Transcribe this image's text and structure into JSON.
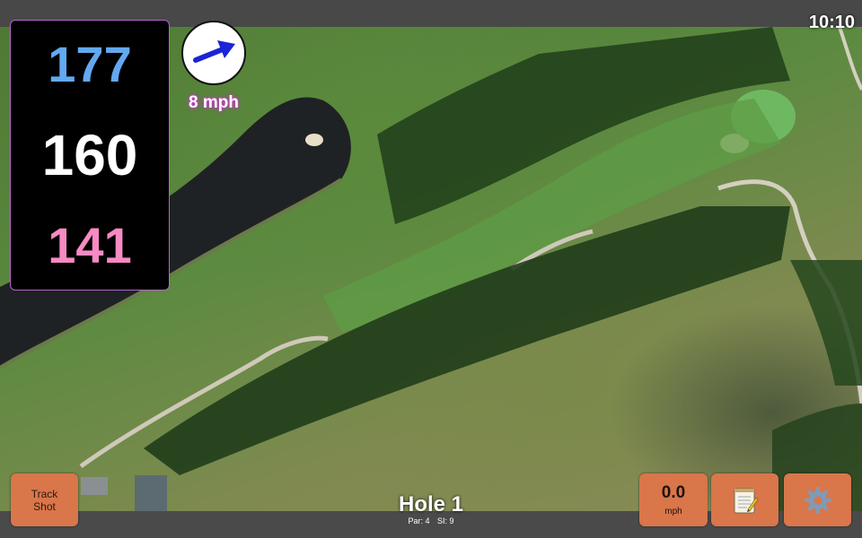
{
  "status_bar": {
    "time": "10:10"
  },
  "yardages": {
    "back": "177",
    "center": "160",
    "front": "141"
  },
  "wind": {
    "speed_label": "8 mph",
    "direction_icon": "arrow-icon"
  },
  "hole": {
    "title": "Hole 1",
    "par_label": "Par: 4",
    "si_label": "SI: 9"
  },
  "buttons": {
    "track_shot_line1": "Track",
    "track_shot_line2": "Shot",
    "speed_value": "0.0",
    "speed_unit": "mph",
    "notes_icon": "notepad-icon",
    "settings_icon": "gear-icon"
  },
  "colors": {
    "back_yardage": "#62a9ef",
    "center_yardage": "#ffffff",
    "front_yardage": "#f78ac3",
    "button_bg": "#d9764a",
    "wind_arrow": "#1b24d6"
  }
}
